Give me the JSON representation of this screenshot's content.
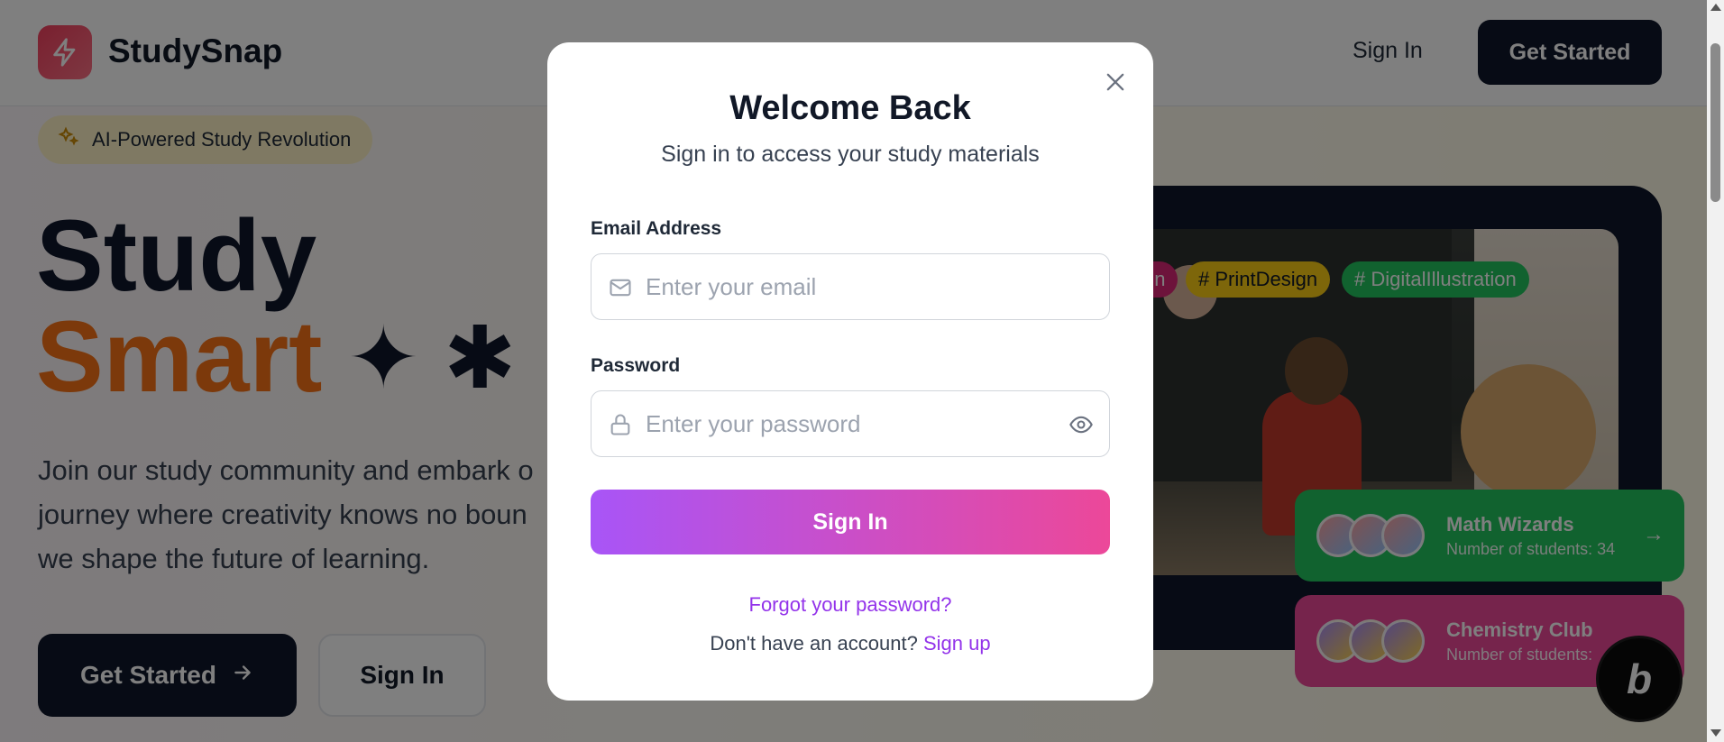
{
  "nav": {
    "brand": "StudySnap",
    "sign_in": "Sign In",
    "get_started": "Get Started"
  },
  "hero": {
    "badge": "AI-Powered Study Revolution",
    "title_line1": "Study",
    "title_line2": "Smart",
    "title_decoration": "✦ ✱",
    "description_lines": [
      "Join our study community and embark o",
      "journey where creativity knows no boun",
      "we shape the future of learning."
    ],
    "primary_button": "Get Started",
    "secondary_button": "Sign In"
  },
  "showcase": {
    "tags": [
      "gn",
      "# PrintDesign",
      "# DigitalIllustration"
    ],
    "clubs": [
      {
        "name": "Math Wizards",
        "count": "Number of students: 34"
      },
      {
        "name": "Chemistry Club",
        "count": "Number of students: "
      }
    ],
    "badge_letter": "b"
  },
  "modal": {
    "title": "Welcome Back",
    "subtitle": "Sign in to access your study materials",
    "email_label": "Email Address",
    "email_placeholder": "Enter your email",
    "password_label": "Password",
    "password_placeholder": "Enter your password",
    "submit": "Sign In",
    "forgot": "Forgot your password?",
    "no_account": "Don't have an account?",
    "sign_up": "Sign up"
  },
  "colors": {
    "accent_purple": "#a855f7",
    "accent_pink": "#ec4899",
    "link": "#9333ea",
    "hero_orange": "#f97316",
    "dark": "#0f172a"
  },
  "icons": [
    "lightning-icon",
    "sparkles-icon",
    "arrow-right-icon",
    "close-icon",
    "mail-icon",
    "lock-icon",
    "eye-icon"
  ]
}
